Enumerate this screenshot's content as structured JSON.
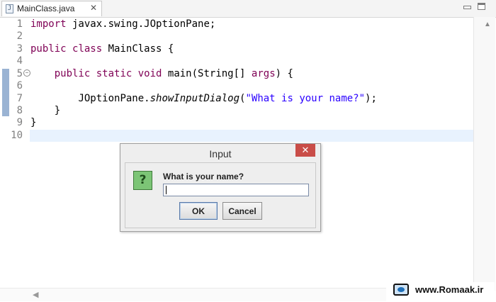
{
  "editor": {
    "tab_icon": "java-file-icon",
    "tab_icon_letter": "J",
    "tab_label": "MainClass.java",
    "tab_close": "✕",
    "minimize_icon": "minimize-icon",
    "maximize_icon": "maximize-icon",
    "fold_marker": "−",
    "lines": [
      {
        "num": "1",
        "text": "import javax.swing.JOptionPane;"
      },
      {
        "num": "2",
        "text": ""
      },
      {
        "num": "3",
        "text": "public class MainClass {"
      },
      {
        "num": "4",
        "text": ""
      },
      {
        "num": "5",
        "text": "    public static void main(String[] args) {"
      },
      {
        "num": "6",
        "text": ""
      },
      {
        "num": "7",
        "text": "        JOptionPane.showInputDialog(\"What is your name?\");"
      },
      {
        "num": "8",
        "text": "    }"
      },
      {
        "num": "9",
        "text": "}"
      },
      {
        "num": "10",
        "text": ""
      }
    ],
    "code": {
      "l1_kw": "import",
      "l1_rest": " javax.swing.JOptionPane;",
      "l3_kw1": "public",
      "l3_kw2": "class",
      "l3_rest": " MainClass {",
      "l5_indent": "    ",
      "l5_kw1": "public",
      "l5_kw2": "static",
      "l5_kw3": "void",
      "l5_mid": " main(String[] ",
      "l5_args": "args",
      "l5_end": ") {",
      "l7_indent": "        ",
      "l7_cls": "JOptionPane.",
      "l7_method": "showInputDialog",
      "l7_open": "(",
      "l7_str": "\"What is your name?\"",
      "l7_close": ");",
      "l8": "    }",
      "l9": "}"
    },
    "colors": {
      "keyword": "#7f0055",
      "string": "#2a00ff",
      "current_line": "#e8f2fe"
    }
  },
  "dialog": {
    "title": "Input",
    "close_glyph": "✕",
    "icon": "question-icon",
    "icon_glyph": "?",
    "message": "What is your name?",
    "input_value": "",
    "ok_label": "OK",
    "cancel_label": "Cancel"
  },
  "scrollbar": {
    "up_arrow": "▲",
    "left_arrow": "◀"
  },
  "watermark": {
    "logo": "romaak-logo",
    "text": "www.Romaak.ir"
  }
}
